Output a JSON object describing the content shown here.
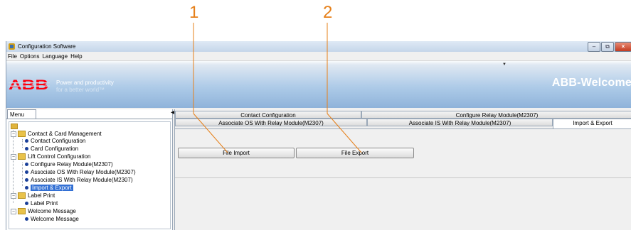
{
  "callouts": [
    "1",
    "2"
  ],
  "window": {
    "title": "Configuration Software"
  },
  "menubar": [
    "File",
    "Options",
    "Language",
    "Help"
  ],
  "banner": {
    "brand": "ABB",
    "tagline_1": "Power and productivity",
    "tagline_2": "for a better world™",
    "welcome": "ABB-Welcome"
  },
  "menu": {
    "tab_label": "Menu",
    "tree": [
      {
        "label": "Contact & Card Management",
        "children": [
          "Contact Configuration",
          "Card Configuration"
        ]
      },
      {
        "label": "Lift Control Configuration",
        "children": [
          "Configure Relay Module(M2307)",
          "Associate OS With Relay Module(M2307)",
          "Associate IS With Relay Module(M2307)",
          "Import & Export"
        ]
      },
      {
        "label": "Label Print",
        "children": [
          "Label Print"
        ]
      },
      {
        "label": "Welcome Message",
        "children": [
          "Welcome Message"
        ]
      }
    ],
    "selected": "Import & Export"
  },
  "tabs": {
    "row1": [
      "Contact Configuration",
      "Configure Relay Module(M2307)"
    ],
    "row2": [
      "Associate OS With Relay Module(M2307)",
      "Associate IS With Relay Module(M2307)",
      "Import & Export"
    ],
    "active": "Import & Export"
  },
  "actions": {
    "import_label": "File Import",
    "export_label": "File Export"
  },
  "colors": {
    "callout": "#e6801a",
    "brand_red": "#ff000f",
    "selection": "#3370d4",
    "banner_blue": "#8fb3da"
  }
}
